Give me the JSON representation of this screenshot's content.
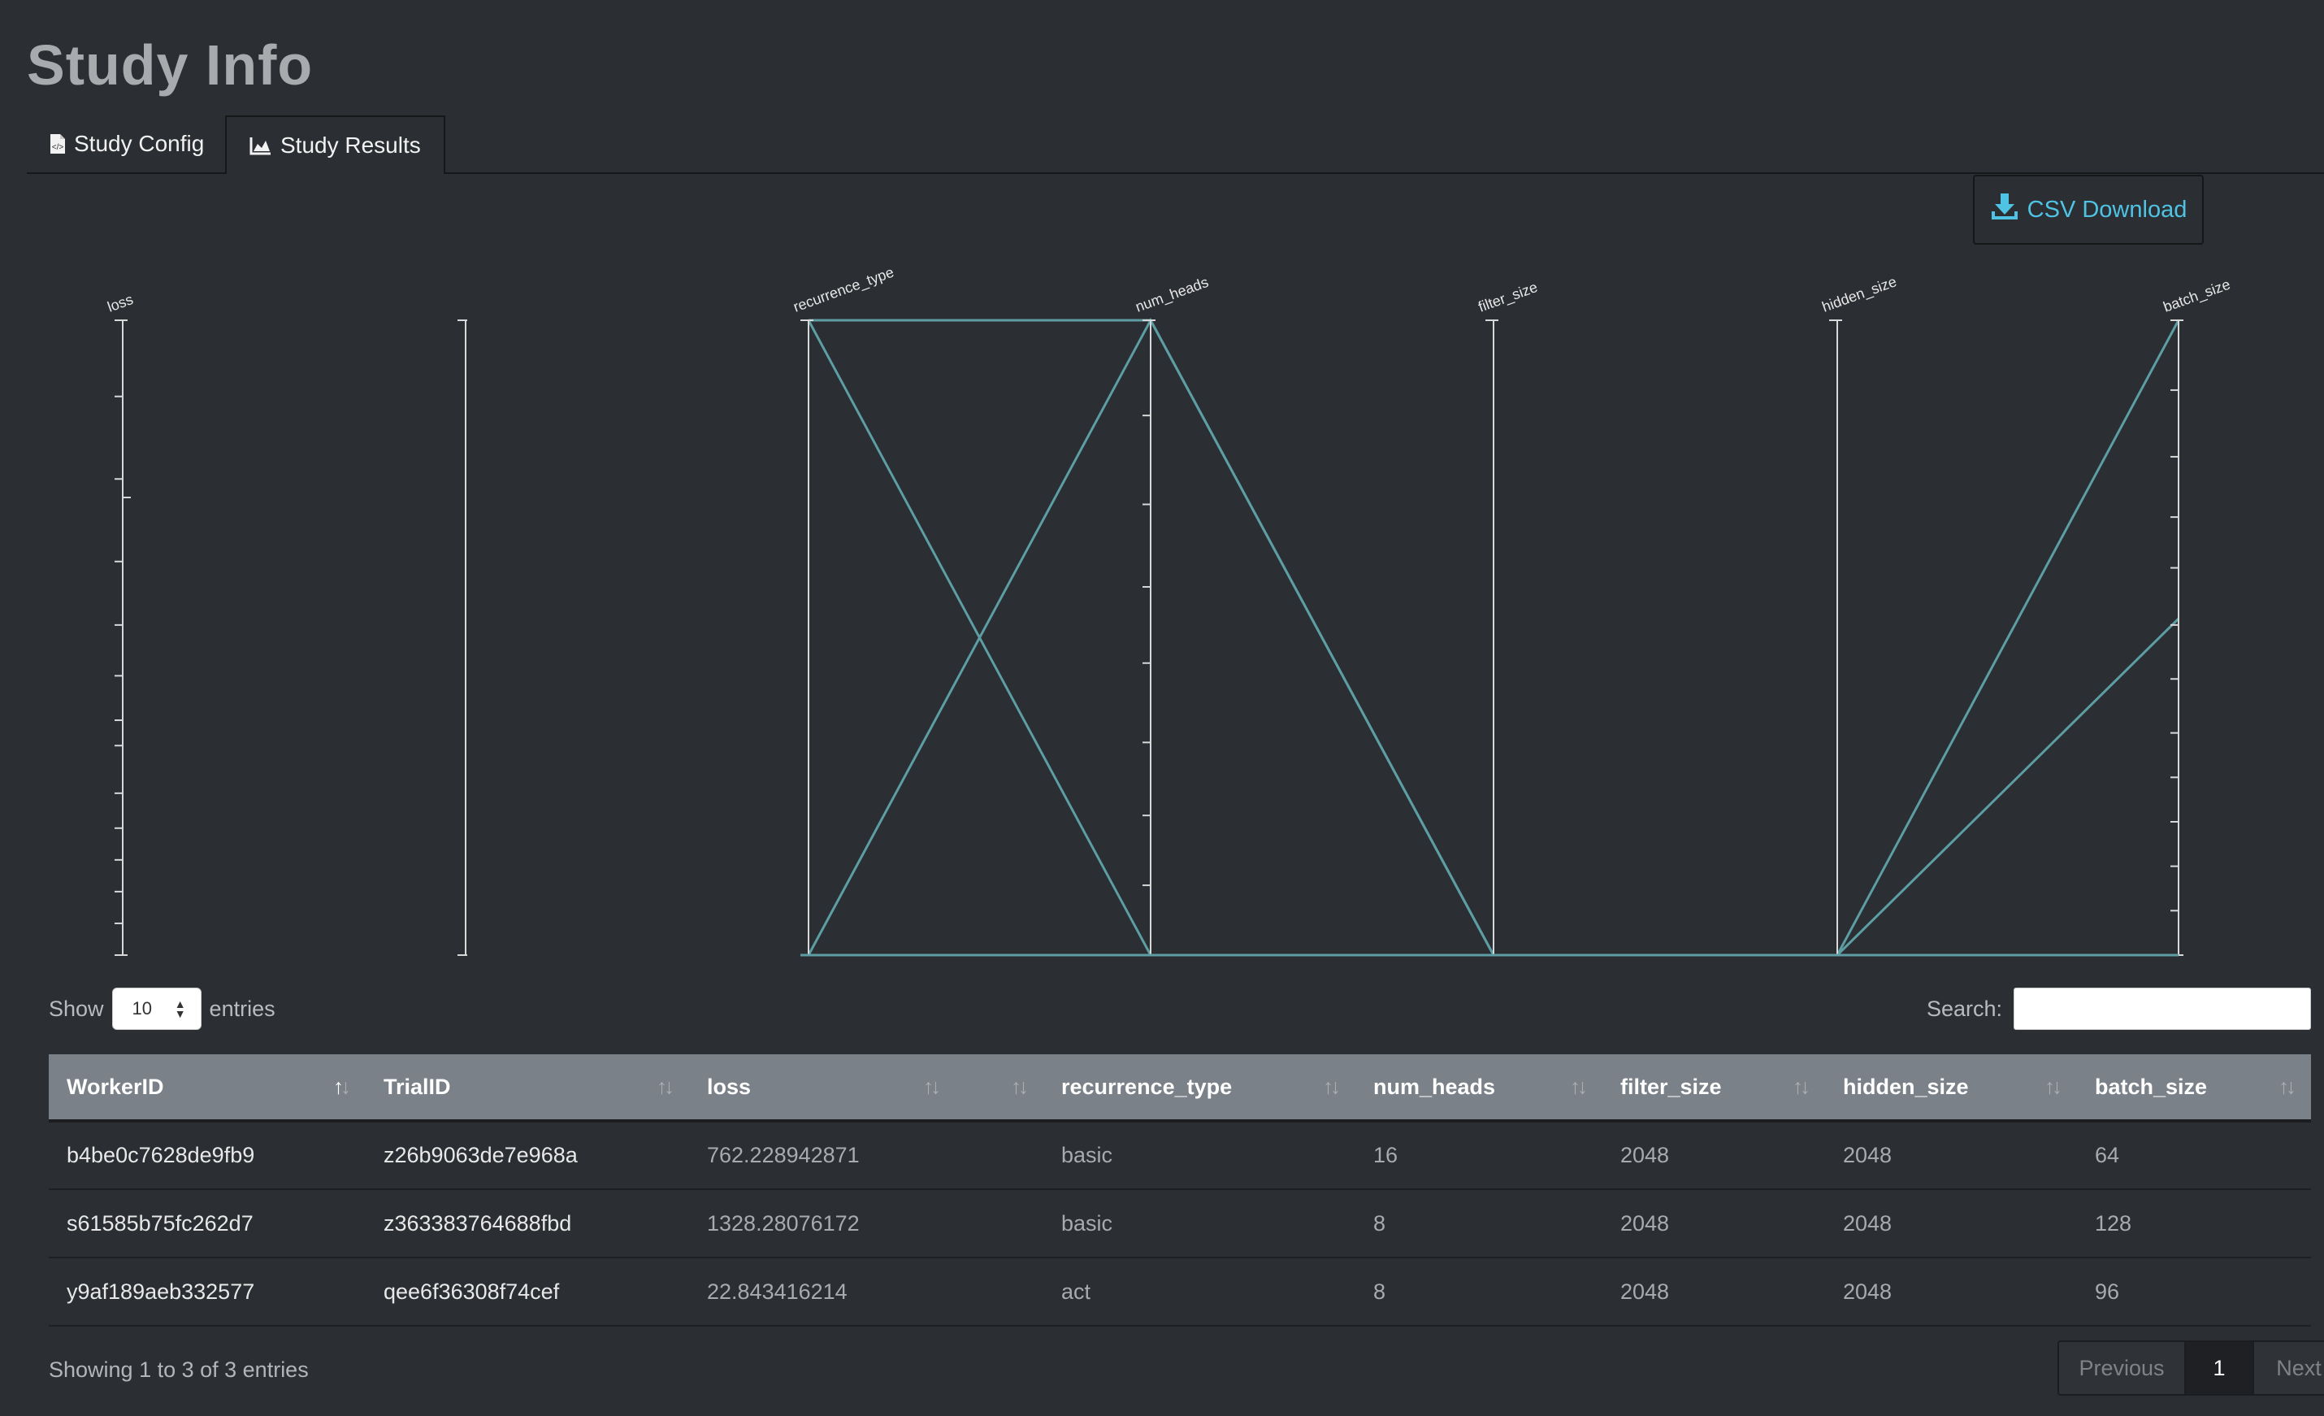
{
  "page": {
    "title": "Study Info",
    "tabs": [
      {
        "label": "Study Config",
        "icon": "file-code-icon"
      },
      {
        "label": "Study Results",
        "icon": "area-chart-icon"
      }
    ],
    "csv_button": "CSV Download",
    "show_label": "Show",
    "entries_label": "entries",
    "page_length": "10",
    "search_label": "Search:",
    "info": "Showing 1 to 3 of 3 entries",
    "pager": {
      "previous": "Previous",
      "current": "1",
      "next": "Next"
    }
  },
  "colors": {
    "line": "#5c9ea3",
    "accent": "#4fc3e4",
    "header_bg": "#7a8188"
  },
  "table": {
    "columns": [
      "WorkerID",
      "TrialID",
      "loss",
      "",
      "recurrence_type",
      "num_heads",
      "filter_size",
      "hidden_size",
      "batch_size"
    ],
    "rows": [
      [
        "b4be0c7628de9fb9",
        "z26b9063de7e968a",
        "762.228942871",
        "",
        "basic",
        "16",
        "2048",
        "2048",
        "64"
      ],
      [
        "s61585b75fc262d7",
        "z363383764688fbd",
        "1328.28076172",
        "",
        "basic",
        "8",
        "2048",
        "2048",
        "128"
      ],
      [
        "y9af189aeb332577",
        "qee6f36308f74cef",
        "22.843416214",
        "",
        "act",
        "8",
        "2048",
        "2048",
        "96"
      ]
    ]
  },
  "chart_data": {
    "type": "parallel-coordinates",
    "axes": [
      "loss",
      "",
      "recurrence_type",
      "num_heads",
      "filter_size",
      "hidden_size",
      "batch_size"
    ],
    "records": [
      {
        "recurrence_type": 1,
        "num_heads": 0,
        "filter_size": 0,
        "hidden_size": 0,
        "batch_size": 0
      },
      {
        "recurrence_type": 1,
        "num_heads": 1,
        "filter_size": 0,
        "hidden_size": 0,
        "batch_size": 1
      },
      {
        "recurrence_type": 0,
        "num_heads": 1,
        "filter_size": 0,
        "hidden_size": 0,
        "batch_size": 0.53
      }
    ]
  }
}
